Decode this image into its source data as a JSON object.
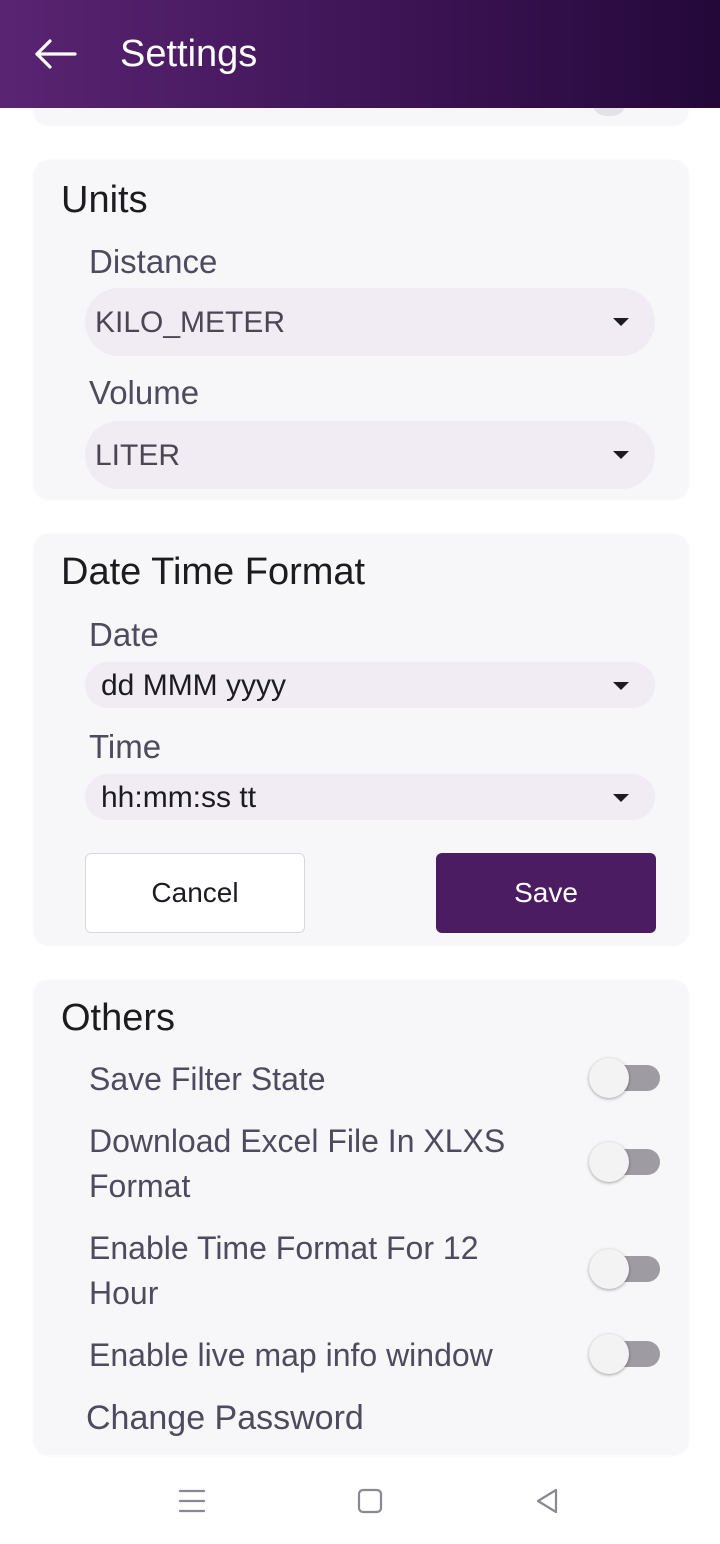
{
  "header": {
    "title": "Settings",
    "back_icon": "arrow-left-icon"
  },
  "units": {
    "title": "Units",
    "distance_label": "Distance",
    "distance_value": "KILO_METER",
    "volume_label": "Volume",
    "volume_value": "LITER"
  },
  "datetime": {
    "title": "Date Time Format",
    "date_label": "Date",
    "date_value": "dd MMM yyyy",
    "time_label": "Time",
    "time_value": "hh:mm:ss tt",
    "cancel_label": "Cancel",
    "save_label": "Save"
  },
  "others": {
    "title": "Others",
    "items": [
      {
        "label": "Save Filter State",
        "enabled": false
      },
      {
        "label": "Download Excel File In XLXS Format",
        "enabled": false
      },
      {
        "label": "Enable Time Format For 12 Hour",
        "enabled": false
      },
      {
        "label": "Enable live map info window",
        "enabled": false
      }
    ],
    "change_password_label": "Change Password"
  },
  "colors": {
    "appbar_start": "#5a2472",
    "appbar_end": "#24083a",
    "primary_button": "#4c1c62",
    "card_background": "#f7f6f9",
    "dropdown_background": "#f1ebf3"
  },
  "navbar": {
    "icons": [
      "menu-icon",
      "home-square-icon",
      "back-triangle-icon"
    ]
  }
}
